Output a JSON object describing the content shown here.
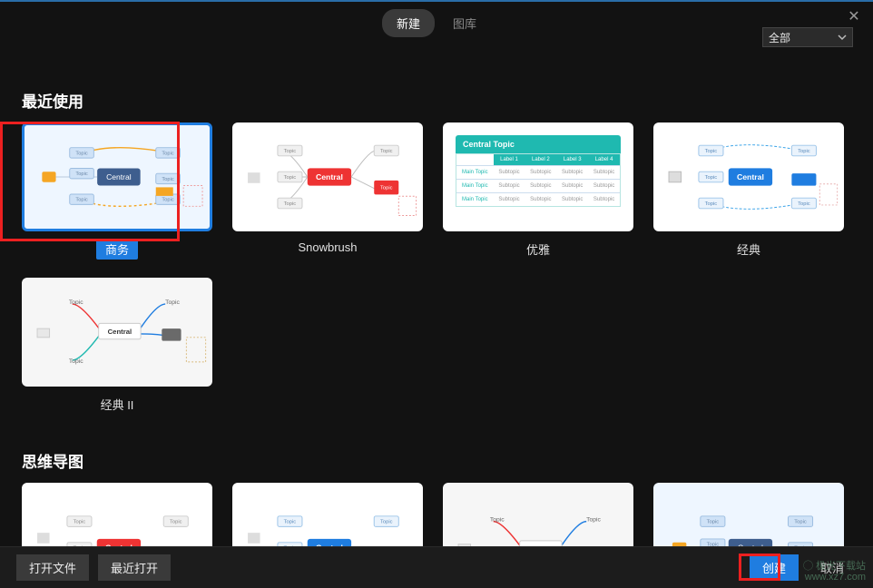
{
  "topbar": {
    "tab_new": "新建",
    "tab_gallery": "图库",
    "close": "✕",
    "filter_label": "全部"
  },
  "sections": {
    "recent": "最近使用",
    "mindmap": "思维导图"
  },
  "cards": {
    "recent": [
      {
        "label": "商务",
        "selected": true
      },
      {
        "label": "Snowbrush"
      },
      {
        "label": "优雅"
      },
      {
        "label": "经典"
      },
      {
        "label": "经典 II"
      }
    ]
  },
  "thumb_text": {
    "central": "Central",
    "central_topic": "Central Topic",
    "topic": "Topic",
    "main_topic": "Main Topic",
    "subtopic": "Subtopic",
    "label1": "Label 1",
    "label2": "Label 2",
    "label3": "Label 3",
    "label4": "Label 4"
  },
  "bottom": {
    "open_file": "打开文件",
    "recent_open": "最近打开",
    "create": "创建",
    "cancel": "取消"
  },
  "watermark": {
    "l1": "◯ 极光下载站",
    "l2": "www.xz7.com"
  },
  "colors": {
    "accent": "#1f7de0",
    "red": "#e33",
    "teal": "#1fb9b0",
    "orange": "#f5a623"
  }
}
